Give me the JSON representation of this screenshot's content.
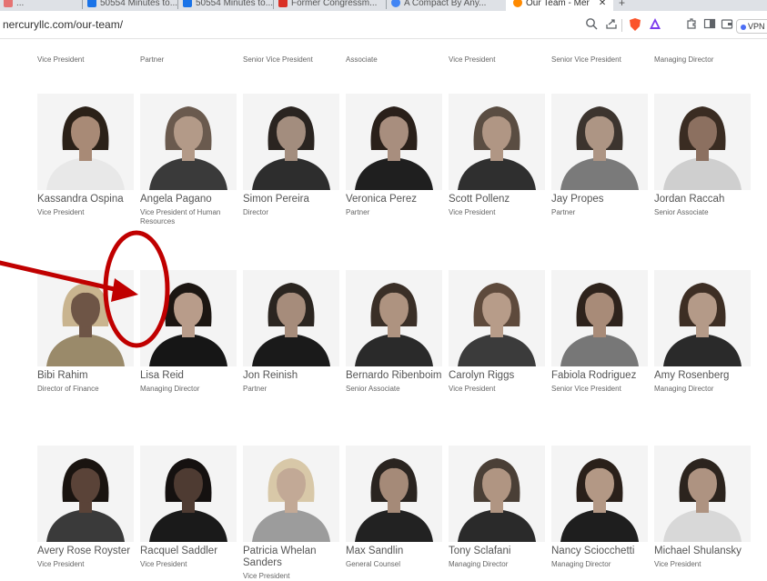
{
  "browser": {
    "tabs": [
      {
        "label": "...",
        "color": "#e57373"
      },
      {
        "label": "50554 Minutes to...",
        "color": "#1a73e8"
      },
      {
        "label": "50554 Minutes to...",
        "color": "#1a73e8"
      },
      {
        "label": "Former Congressm...",
        "color": "#d93025"
      },
      {
        "label": "A Compact By Any...",
        "color": "#4285f4"
      },
      {
        "label": "Our Team - Mer",
        "color": "#ff8a00"
      }
    ],
    "url": "nercuryllc.com/our-team/",
    "vpn_label": "VPN"
  },
  "top_row": [
    {
      "role": "Vice President"
    },
    {
      "role": "Partner"
    },
    {
      "role": "Senior Vice President"
    },
    {
      "role": "Associate"
    },
    {
      "role": "Vice President"
    },
    {
      "role": "Senior Vice President"
    },
    {
      "role": "Managing Director"
    }
  ],
  "team_rows": [
    [
      {
        "name": "Kassandra Ospina",
        "role": "Vice President",
        "skin": "#a88a76",
        "hair": "#2b2118",
        "shirt": "#e8e8e8"
      },
      {
        "name": "Angela Pagano",
        "role": "Vice President of Human Resources",
        "skin": "#b39a88",
        "hair": "#6a5a4e",
        "shirt": "#3a3a3a"
      },
      {
        "name": "Simon Pereira",
        "role": "Director",
        "skin": "#a38d7e",
        "hair": "#2a2420",
        "shirt": "#2d2d2d"
      },
      {
        "name": "Veronica Perez",
        "role": "Partner",
        "skin": "#a88e7e",
        "hair": "#2a201a",
        "shirt": "#1f1f1f"
      },
      {
        "name": "Scott Pollenz",
        "role": "Vice President",
        "skin": "#b09684",
        "hair": "#5a4d42",
        "shirt": "#2f2f2f"
      },
      {
        "name": "Jay Propes",
        "role": "Partner",
        "skin": "#ad9584",
        "hair": "#3c342e",
        "shirt": "#7a7a7a"
      },
      {
        "name": "Jordan Raccah",
        "role": "Senior Associate",
        "skin": "#8c7060",
        "hair": "#3a2c22",
        "shirt": "#cfcfcf"
      }
    ],
    [
      {
        "name": "Bibi Rahim",
        "role": "Director of Finance",
        "skin": "#6e5546",
        "hair": "#c9b48f",
        "shirt": "#9a8a6a"
      },
      {
        "name": "Lisa Reid",
        "role": "Managing Director",
        "skin": "#b89c8a",
        "hair": "#1c1612",
        "shirt": "#161616"
      },
      {
        "name": "Jon Reinish",
        "role": "Partner",
        "skin": "#a68c7b",
        "hair": "#2b2520",
        "shirt": "#1a1a1a"
      },
      {
        "name": "Bernardo Ribenboim",
        "role": "Senior Associate",
        "skin": "#ae9380",
        "hair": "#3a2f27",
        "shirt": "#2a2a2a"
      },
      {
        "name": "Carolyn Riggs",
        "role": "Vice President",
        "skin": "#b79c89",
        "hair": "#5e4a3c",
        "shirt": "#3b3b3b"
      },
      {
        "name": "Fabiola Rodriguez",
        "role": "Senior Vice President",
        "skin": "#a88b78",
        "hair": "#2e231c",
        "shirt": "#777777"
      },
      {
        "name": "Amy Rosenberg",
        "role": "Managing Director",
        "skin": "#b49a88",
        "hair": "#3d2e24",
        "shirt": "#2a2a2a"
      }
    ],
    [
      {
        "name": "Avery Rose Royster",
        "role": "Vice President",
        "skin": "#5a4338",
        "hair": "#1a1410",
        "shirt": "#3a3a3a"
      },
      {
        "name": "Racquel Saddler",
        "role": "Vice President",
        "skin": "#4e3b32",
        "hair": "#151110",
        "shirt": "#1a1a1a"
      },
      {
        "name": "Patricia Whelan Sanders",
        "role": "Vice President",
        "skin": "#c2a996",
        "hair": "#d8c8a8",
        "shirt": "#9c9c9c"
      },
      {
        "name": "Max Sandlin",
        "role": "General Counsel",
        "skin": "#a58a78",
        "hair": "#2a2420",
        "shirt": "#222222"
      },
      {
        "name": "Tony Sclafani",
        "role": "Managing Director",
        "skin": "#b09582",
        "hair": "#4a3f36",
        "shirt": "#2a2a2a"
      },
      {
        "name": "Nancy Sciocchetti",
        "role": "Managing Director",
        "skin": "#b39885",
        "hair": "#2a201a",
        "shirt": "#1e1e1e"
      },
      {
        "name": "Michael Shulansky",
        "role": "Vice President",
        "skin": "#ae9381",
        "hair": "#2c241e",
        "shirt": "#d8d8d8"
      }
    ]
  ],
  "annotation_color": "#c00000"
}
